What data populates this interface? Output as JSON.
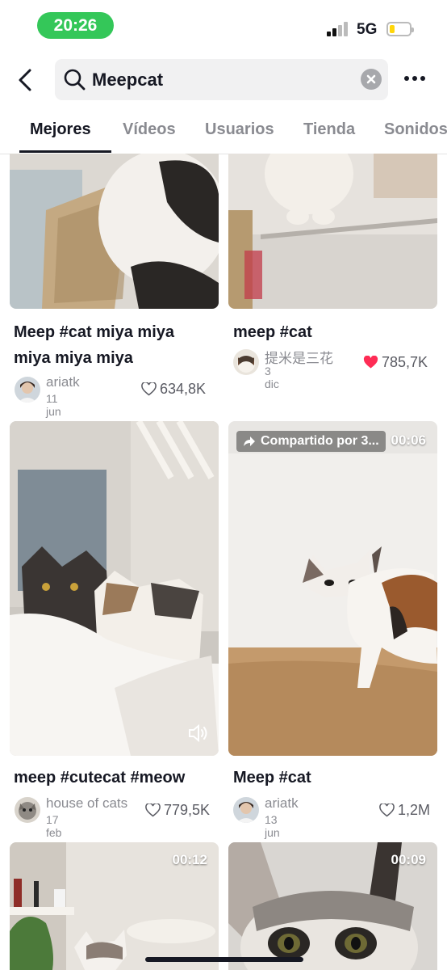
{
  "status": {
    "time": "20:26",
    "network": "5G"
  },
  "search": {
    "query": "Meepcat"
  },
  "tabs": [
    {
      "label": "Mejores",
      "active": true
    },
    {
      "label": "Vídeos",
      "active": false
    },
    {
      "label": "Usuarios",
      "active": false
    },
    {
      "label": "Tienda",
      "active": false
    },
    {
      "label": "Sonidos",
      "active": false
    }
  ],
  "results": [
    {
      "caption": "Meep #cat miya miya miya miya miya",
      "user": "ariatk",
      "date": "11 jun",
      "likes": "634,8K",
      "liked": false
    },
    {
      "caption": "meep #cat",
      "user": "提米是三花",
      "date": "3 dic",
      "likes": "785,7K",
      "liked": true
    },
    {
      "caption": "meep #cutecat #meow",
      "user": "house of cats",
      "date": "17 feb",
      "likes": "779,5K",
      "liked": false
    },
    {
      "caption": "Meep #cat",
      "user": "ariatk",
      "date": "13 jun",
      "likes": "1,2M",
      "liked": false,
      "shared_label": "Compartido por 3...",
      "duration": "00:06"
    },
    {
      "duration": "00:12"
    },
    {
      "duration": "00:09"
    }
  ],
  "icons": {
    "back": "chevron-left-icon",
    "search": "magnifier-icon",
    "clear": "clear-icon",
    "more": "more-horizontal-icon",
    "like": "heart-icon",
    "sound": "speaker-icon",
    "share": "share-arrow-icon"
  },
  "colors": {
    "status_pill": "#34c759",
    "like_red": "#fe2c55",
    "text": "#161823",
    "muted": "#8a8b91"
  }
}
